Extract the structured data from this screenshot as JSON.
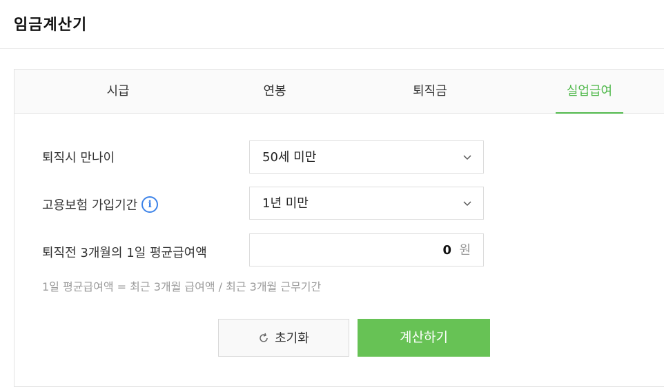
{
  "app_title": "임금계산기",
  "tabs": [
    {
      "label": "시급",
      "active": false
    },
    {
      "label": "연봉",
      "active": false
    },
    {
      "label": "퇴직금",
      "active": false
    },
    {
      "label": "실업급여",
      "active": true
    }
  ],
  "form": {
    "age": {
      "label": "퇴직시 만나이",
      "value": "50세 미만",
      "icon": "chevron-down-icon"
    },
    "insurance_period": {
      "label": "고용보험 가입기간",
      "value": "1년 미만",
      "info_icon": "i",
      "icon": "chevron-down-icon"
    },
    "avg_wage": {
      "label": "퇴직전 3개월의 1일 평균급여액",
      "value": "0",
      "unit": "원"
    },
    "hint": "1일 평균급여액 = 최근 3개월 급여액 / 최근 3개월 근무기간"
  },
  "buttons": {
    "reset_label": "초기화",
    "calc_label": "계산하기"
  },
  "colors": {
    "accent": "#4fb84a",
    "calc_button": "#67c255",
    "info_icon": "#3b82e8"
  }
}
